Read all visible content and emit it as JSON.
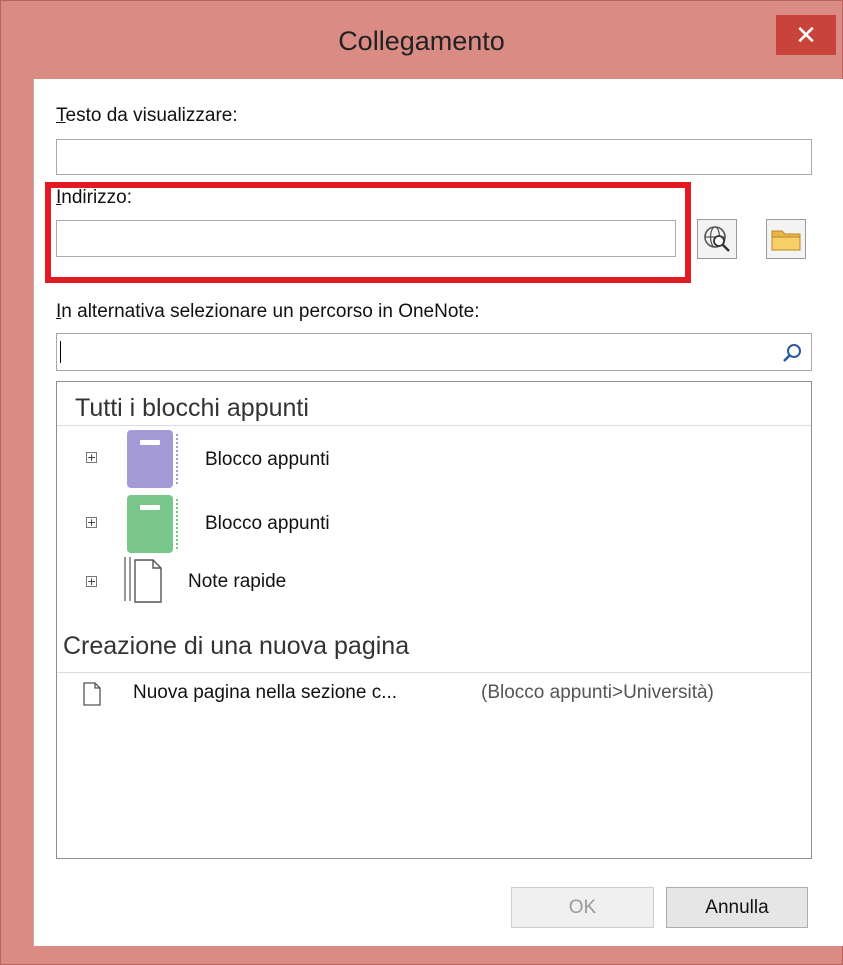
{
  "dialog": {
    "title": "Collegamento",
    "close_label": "✕"
  },
  "fields": {
    "display_text_label_first": "T",
    "display_text_label_rest": "esto da visualizzare:",
    "display_text_value": "",
    "address_label_first": "I",
    "address_label_rest": "ndirizzo:",
    "address_value": "",
    "onenote_label_first": "I",
    "onenote_label_rest": "n alternativa selezionare un percorso in OneNote:",
    "search_value": ""
  },
  "tree": {
    "all_notebooks_header": "Tutti i blocchi appunti",
    "items": [
      {
        "label": "Blocco appunti",
        "color": "#a49bd6"
      },
      {
        "label": "Blocco appunti",
        "color": "#78c68a"
      },
      {
        "label": "Note rapide"
      }
    ],
    "new_page_header": "Creazione di una nuova pagina",
    "new_page_item": "Nuova pagina nella sezione c...",
    "new_page_path": "(Blocco appunti>Università)"
  },
  "buttons": {
    "ok": "OK",
    "cancel": "Annulla"
  },
  "colors": {
    "window_frame": "#d98b84",
    "close_button": "#c8433a",
    "highlight_box": "#e21b22"
  }
}
